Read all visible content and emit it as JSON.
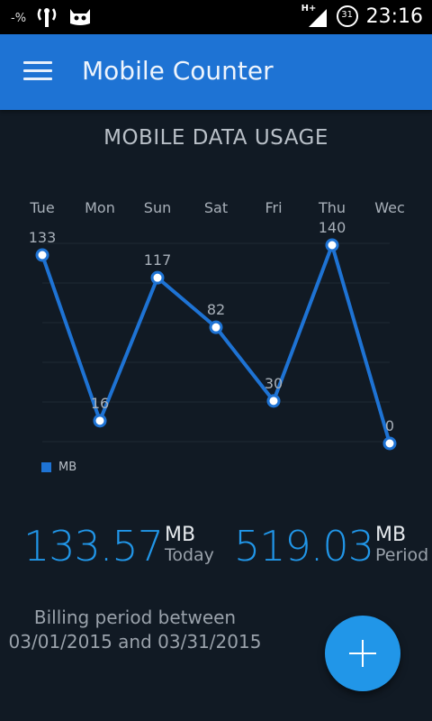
{
  "status_bar": {
    "left_icons": [
      "data-saver-icon",
      "wifi-signal-icon",
      "cyanogen-icon"
    ],
    "data_saver_text": "-%",
    "network_label": "H+",
    "calendar_badge": "31",
    "time": "23:16"
  },
  "app_bar": {
    "title": "Mobile Counter",
    "menu_icon": "hamburger-menu-icon"
  },
  "chart_title": "MOBILE DATA USAGE",
  "chart_data": {
    "type": "line",
    "categories": [
      "Tue",
      "Mon",
      "Sun",
      "Sat",
      "Fri",
      "Thu",
      "Wec"
    ],
    "series": [
      {
        "name": "MB",
        "values": [
          133,
          16,
          117,
          82,
          30,
          140,
          0
        ]
      }
    ],
    "ylim": [
      0,
      140
    ],
    "grid": true,
    "legend": "bottom-left",
    "line_color": "#1e73d4"
  },
  "stats": {
    "today_value": "133.57",
    "today_unit": "MB",
    "today_label": "Today",
    "period_value": "519.03",
    "period_unit": "MB",
    "period_label": "Period"
  },
  "billing": {
    "line1": "Billing period between",
    "line2": "03/01/2015 and 03/31/2015"
  },
  "fab": {
    "icon": "plus-icon"
  },
  "colors": {
    "appbar": "#1e73d4",
    "accent": "#2196e8",
    "background": "#111a24"
  }
}
